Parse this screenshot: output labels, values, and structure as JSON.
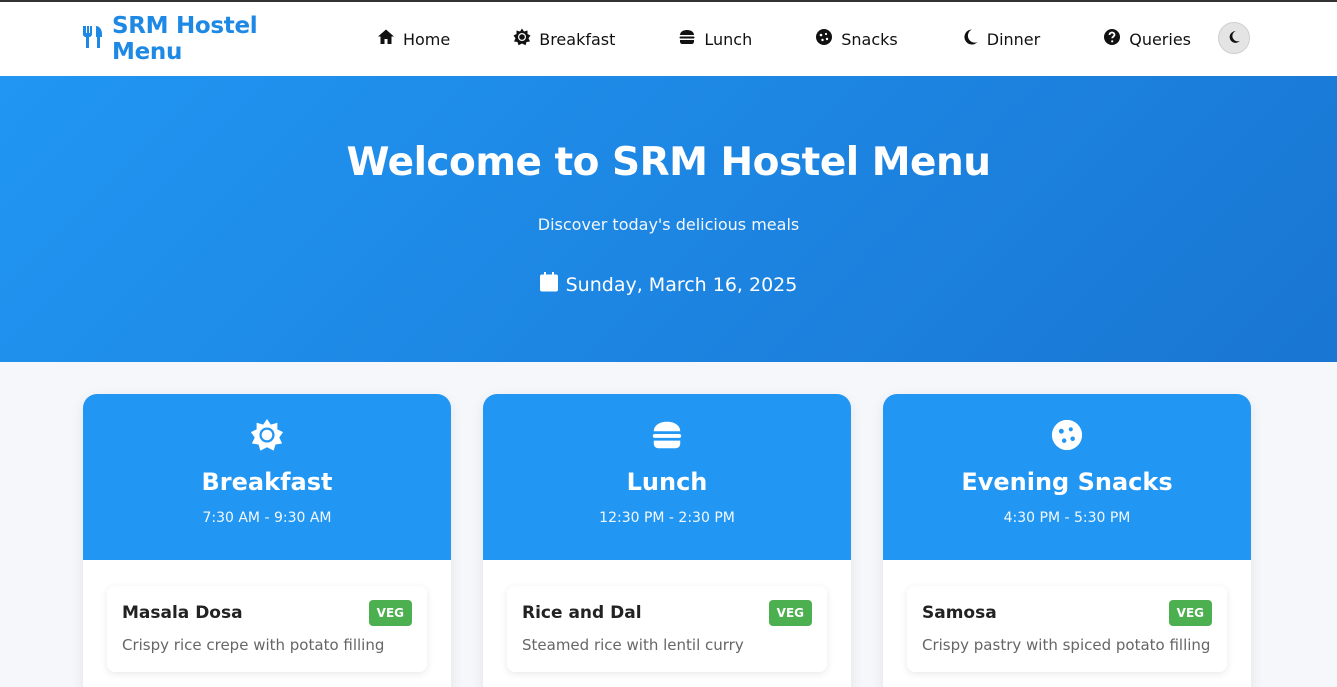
{
  "brand": {
    "title": "SRM Hostel Menu",
    "icon": "utensils-icon",
    "color": "#1e88e5"
  },
  "nav": [
    {
      "label": "Home",
      "icon": "home-icon"
    },
    {
      "label": "Breakfast",
      "icon": "sun-icon"
    },
    {
      "label": "Lunch",
      "icon": "burger-icon"
    },
    {
      "label": "Snacks",
      "icon": "cookie-icon"
    },
    {
      "label": "Dinner",
      "icon": "moon-icon"
    },
    {
      "label": "Queries",
      "icon": "question-circle-icon"
    }
  ],
  "theme_toggle": {
    "icon": "moon-icon"
  },
  "hero": {
    "title": "Welcome to SRM Hostel Menu",
    "subtitle": "Discover today's delicious meals",
    "date": "Sunday, March 16, 2025",
    "date_icon": "calendar-icon",
    "accent": "#2196f3"
  },
  "cards": [
    {
      "title": "Breakfast",
      "time": "7:30 AM - 9:30 AM",
      "icon": "sun-icon",
      "item": {
        "name": "Masala Dosa",
        "badge": "VEG",
        "description": "Crispy rice crepe with potato filling"
      }
    },
    {
      "title": "Lunch",
      "time": "12:30 PM - 2:30 PM",
      "icon": "burger-icon",
      "item": {
        "name": "Rice and Dal",
        "badge": "VEG",
        "description": "Steamed rice with lentil curry"
      }
    },
    {
      "title": "Evening Snacks",
      "time": "4:30 PM - 5:30 PM",
      "icon": "cookie-icon",
      "item": {
        "name": "Samosa",
        "badge": "VEG",
        "description": "Crispy pastry with spiced potato filling"
      }
    }
  ],
  "colors": {
    "veg_badge": "#4caf50",
    "card_header": "#2196f3"
  }
}
